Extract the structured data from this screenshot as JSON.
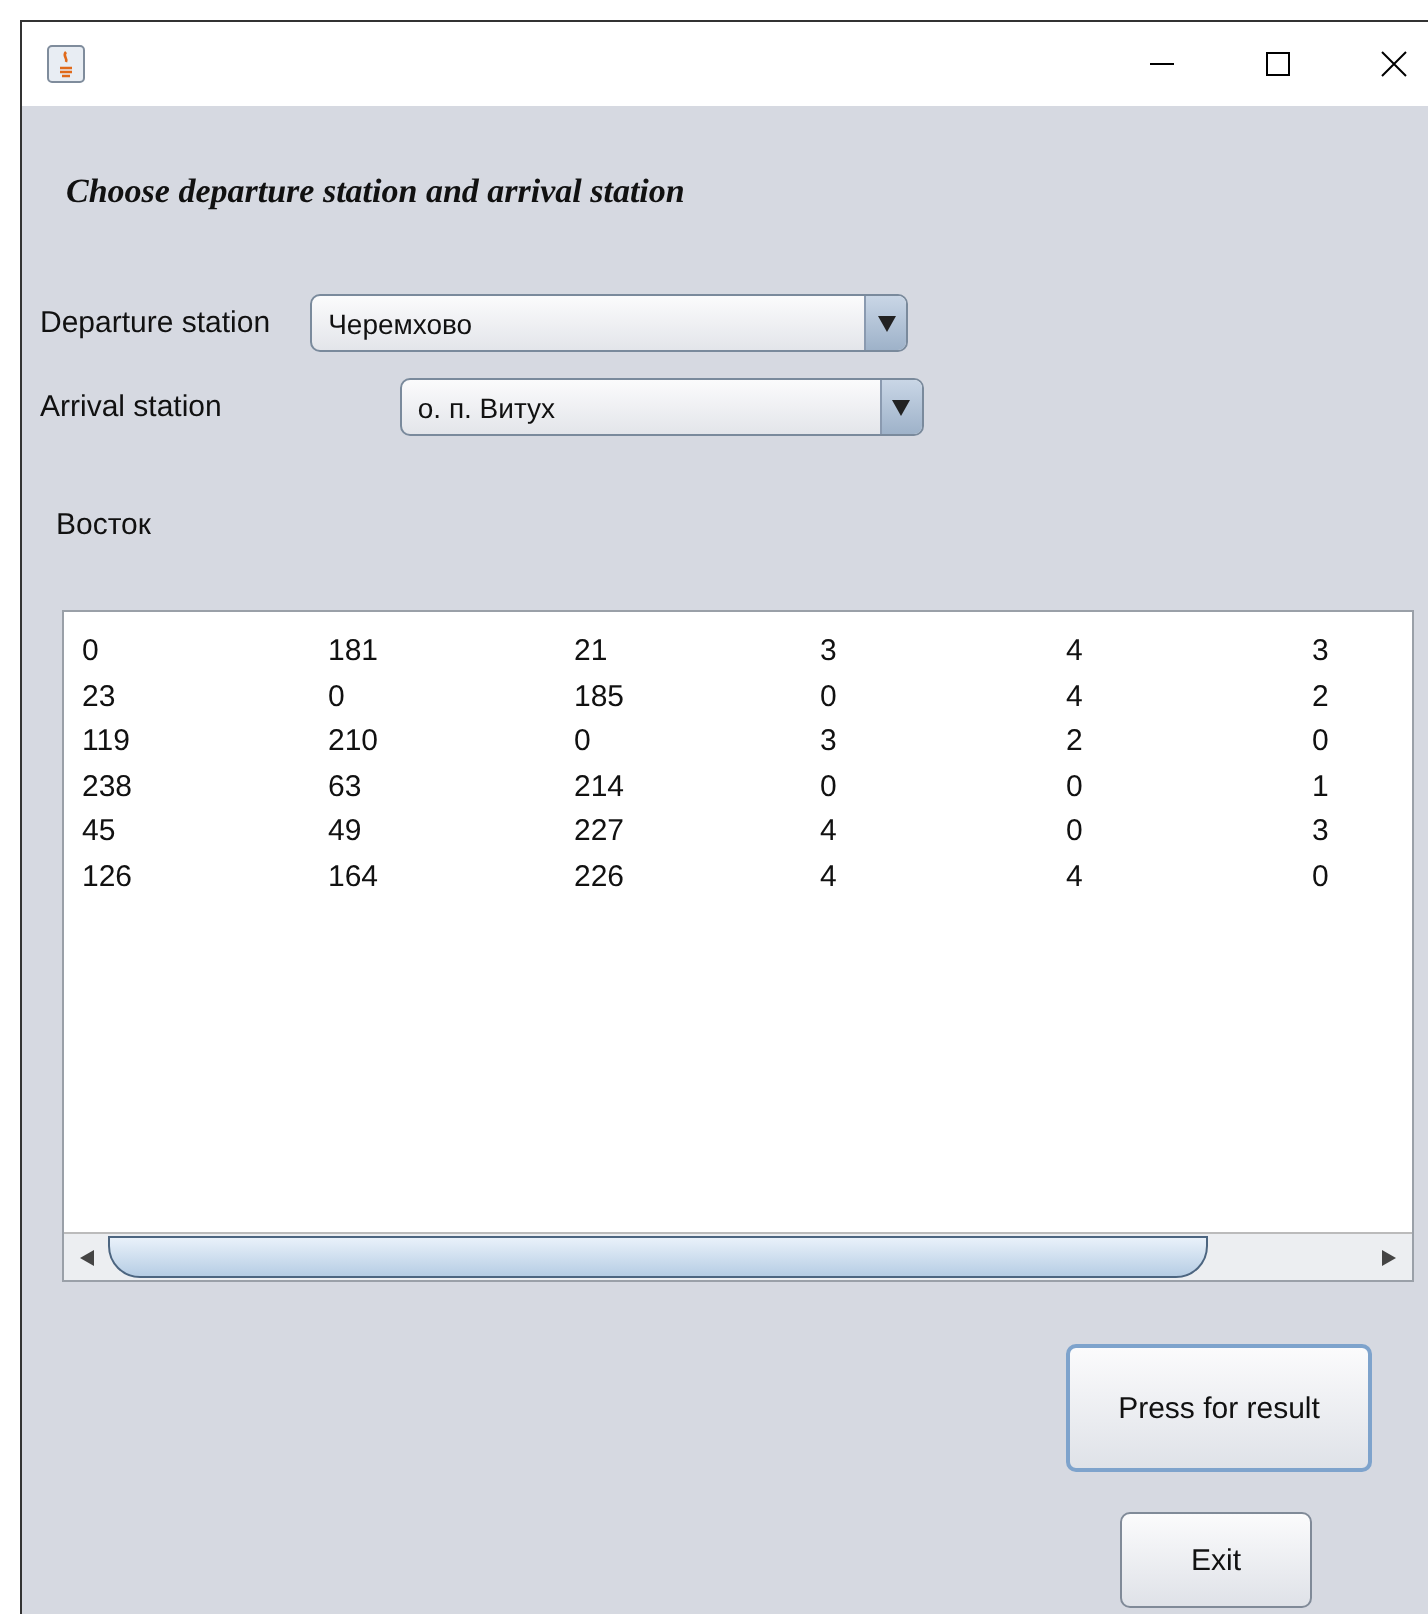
{
  "heading": "Choose departure station and arrival station",
  "departure": {
    "label": "Departure station",
    "value": "Черемхово"
  },
  "arrival": {
    "label": "Arrival station",
    "value": "о. п. Витух"
  },
  "direction": "Восток",
  "matrix": [
    [
      "0",
      "181",
      "21",
      "3",
      "4",
      "3"
    ],
    [
      "23",
      "0",
      "185",
      "0",
      "4",
      "2"
    ],
    [
      "119",
      "210",
      "0",
      "3",
      "2",
      "0"
    ],
    [
      "238",
      "63",
      "214",
      "0",
      "0",
      "1"
    ],
    [
      "45",
      "49",
      "227",
      "4",
      "0",
      "3"
    ],
    [
      "126",
      "164",
      "226",
      "4",
      "4",
      "0"
    ]
  ],
  "buttons": [
    "Press for result",
    "Exit"
  ]
}
